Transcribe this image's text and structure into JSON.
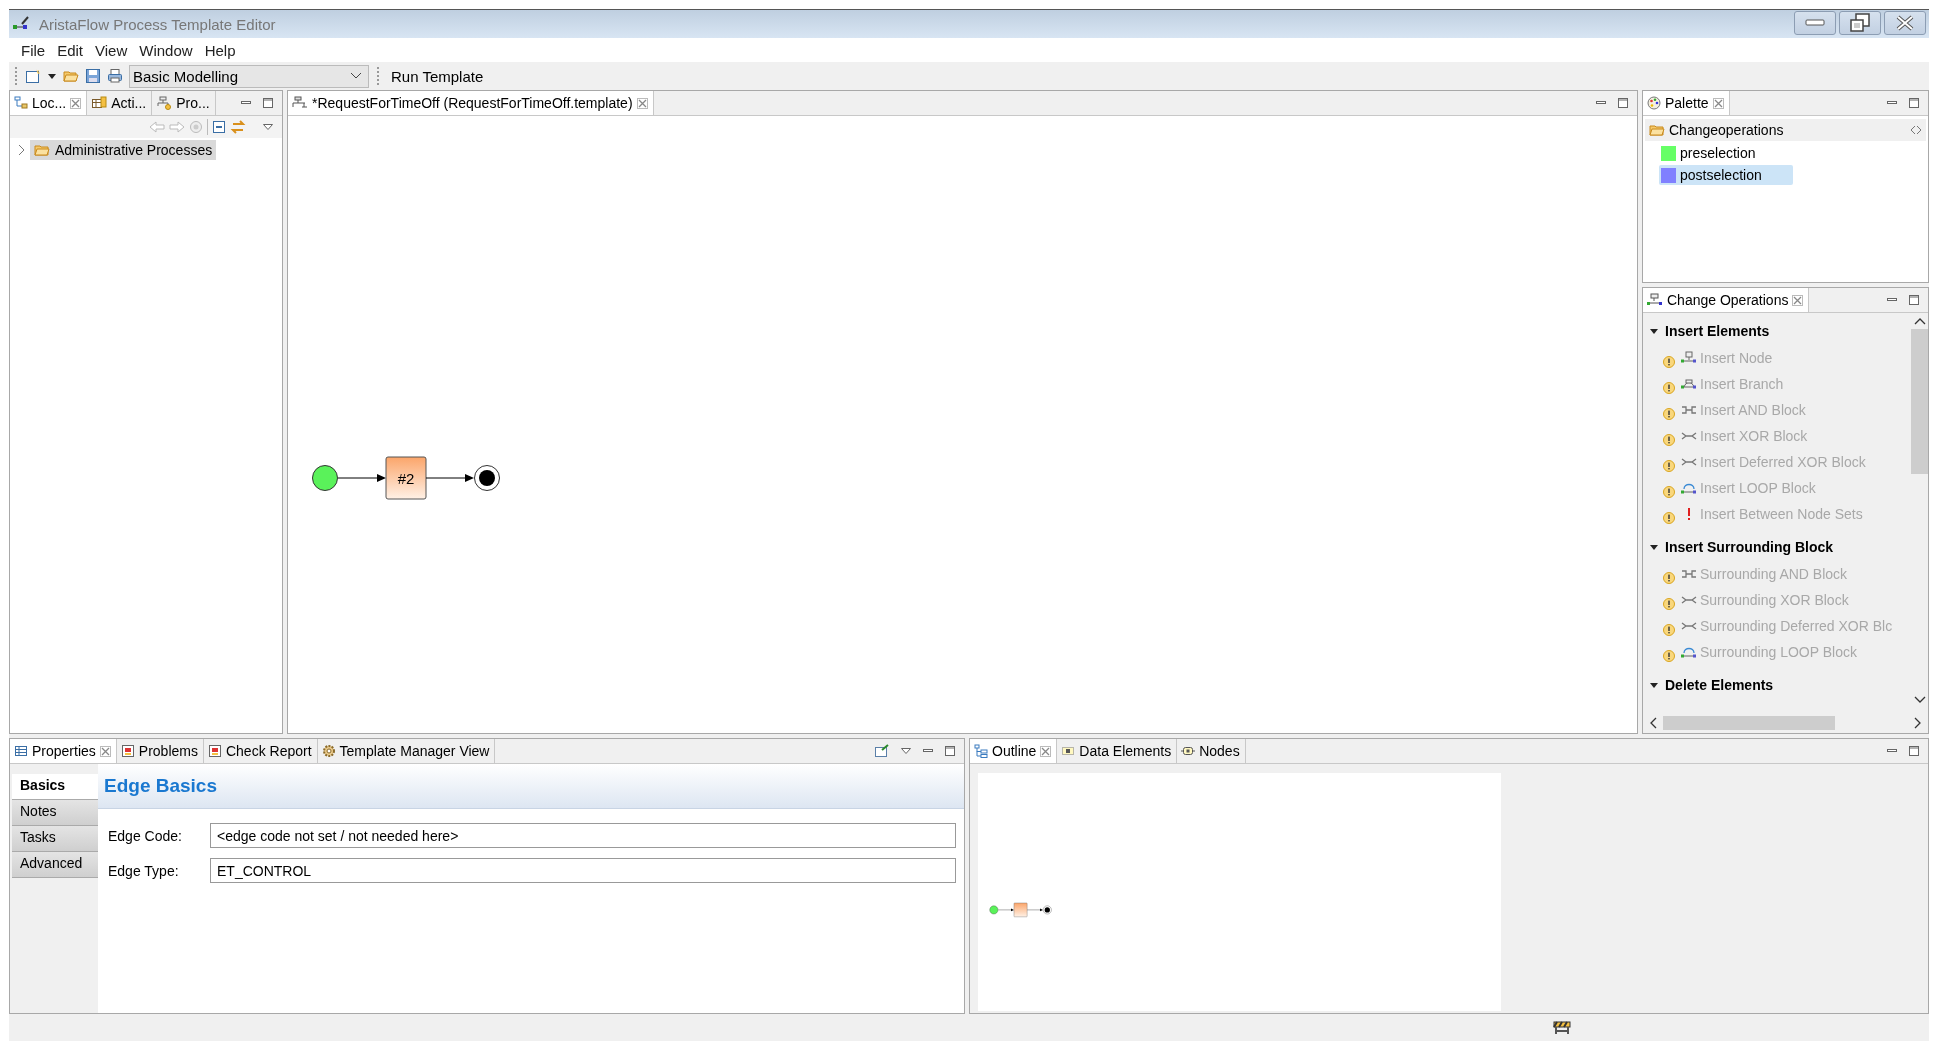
{
  "window": {
    "title": "AristaFlow Process Template Editor"
  },
  "menu": [
    "File",
    "Edit",
    "View",
    "Window",
    "Help"
  ],
  "toolbar": {
    "perspective": "Basic Modelling",
    "run_button": "Run Template"
  },
  "left_panel": {
    "tabs": [
      {
        "label": "Loc...",
        "selected": true
      },
      {
        "label": "Acti...",
        "selected": false
      },
      {
        "label": "Pro...",
        "selected": false
      }
    ],
    "tree": [
      {
        "label": "Administrative Processes",
        "expanded": false,
        "selected": true
      }
    ]
  },
  "editor": {
    "tab": {
      "label": "*RequestForTimeOff (RequestForTimeOff.template)",
      "selected": true
    },
    "nodes": [
      {
        "kind": "start"
      },
      {
        "kind": "activity",
        "label": "#2"
      },
      {
        "kind": "end"
      }
    ]
  },
  "palette": {
    "tab": {
      "label": "Palette",
      "selected": true
    },
    "drawer": {
      "label": "Changeoperations"
    },
    "items": [
      {
        "label": "preselection",
        "color": "#66ff66",
        "selected": false
      },
      {
        "label": "postselection",
        "color": "#8080ff",
        "selected": true
      }
    ]
  },
  "change_operations": {
    "tab": {
      "label": "Change Operations",
      "selected": true
    },
    "groups": [
      {
        "label": "Insert Elements",
        "expanded": true,
        "items": [
          {
            "label": "Insert Node",
            "kind": "node",
            "warning": true,
            "disabled": true
          },
          {
            "label": "Insert Branch",
            "kind": "branch",
            "warning": true,
            "disabled": true
          },
          {
            "label": "Insert AND Block",
            "kind": "and",
            "warning": true,
            "disabled": true
          },
          {
            "label": "Insert XOR Block",
            "kind": "xor",
            "warning": true,
            "disabled": true
          },
          {
            "label": "Insert Deferred XOR Block",
            "kind": "xor",
            "warning": true,
            "disabled": true
          },
          {
            "label": "Insert LOOP Block",
            "kind": "loop",
            "warning": true,
            "disabled": true
          },
          {
            "label": "Insert Between Node Sets",
            "kind": "error",
            "warning": true,
            "disabled": true
          }
        ]
      },
      {
        "label": "Insert Surrounding Block",
        "expanded": true,
        "items": [
          {
            "label": "Surrounding AND Block",
            "kind": "and",
            "warning": true,
            "disabled": true
          },
          {
            "label": "Surrounding XOR Block",
            "kind": "xor",
            "warning": true,
            "disabled": true
          },
          {
            "label": "Surrounding Deferred XOR Blc",
            "kind": "xor",
            "warning": true,
            "disabled": true
          },
          {
            "label": "Surrounding LOOP Block",
            "kind": "loop",
            "warning": true,
            "disabled": true
          }
        ]
      },
      {
        "label": "Delete Elements",
        "expanded": true
      }
    ]
  },
  "properties": {
    "tabs": [
      {
        "label": "Properties",
        "selected": true
      },
      {
        "label": "Problems",
        "selected": false
      },
      {
        "label": "Check Report",
        "selected": false
      },
      {
        "label": "Template Manager View",
        "selected": false
      }
    ],
    "side_tabs": [
      {
        "label": "Basics",
        "selected": true
      },
      {
        "label": "Notes",
        "selected": false
      },
      {
        "label": "Tasks",
        "selected": false
      },
      {
        "label": "Advanced",
        "selected": false
      }
    ],
    "section_title": "Edge Basics",
    "fields": [
      {
        "label": "Edge Code:",
        "value": "<edge code not set / not needed here>"
      },
      {
        "label": "Edge Type:",
        "value": "ET_CONTROL"
      }
    ]
  },
  "outline": {
    "tabs": [
      {
        "label": "Outline",
        "selected": true
      },
      {
        "label": "Data Elements",
        "selected": false
      },
      {
        "label": "Nodes",
        "selected": false
      }
    ]
  }
}
